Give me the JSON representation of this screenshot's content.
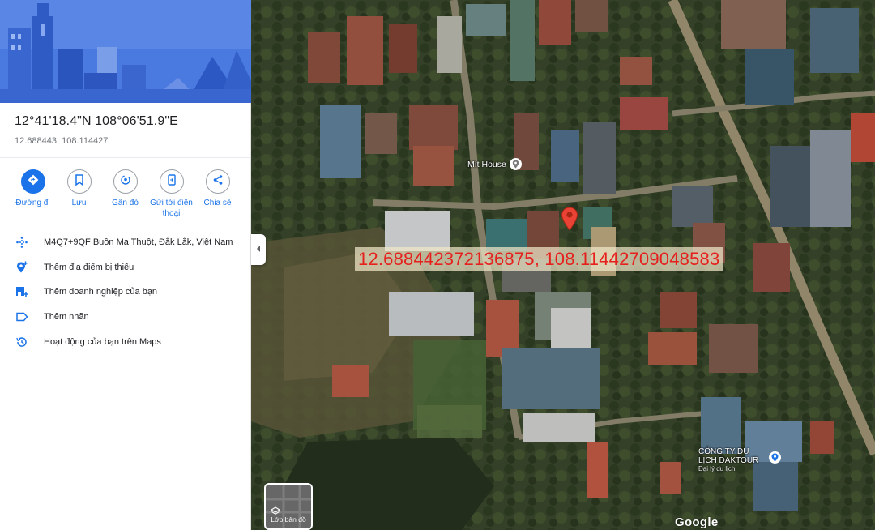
{
  "place": {
    "dms": "12°41'18.4\"N 108°06'51.9\"E",
    "decimal": "12.688443, 108.114427"
  },
  "actions": [
    {
      "label": "Đường đi",
      "icon": "directions-icon"
    },
    {
      "label": "Lưu",
      "icon": "bookmark-icon"
    },
    {
      "label": "Gần đó",
      "icon": "nearby-icon"
    },
    {
      "label": "Gửi tới điện thoại",
      "icon": "send-to-phone-icon"
    },
    {
      "label": "Chia sẻ",
      "icon": "share-icon"
    }
  ],
  "list": [
    {
      "label": "M4Q7+9QF Buôn Ma Thuột, Đắk Lắk, Việt Nam",
      "icon": "plus-code-icon"
    },
    {
      "label": "Thêm địa điểm bị thiếu",
      "icon": "add-place-icon"
    },
    {
      "label": "Thêm doanh nghiệp của bạn",
      "icon": "add-business-icon"
    },
    {
      "label": "Thêm nhãn",
      "icon": "label-icon"
    },
    {
      "label": "Hoạt động của bạn trên Maps",
      "icon": "history-icon"
    }
  ],
  "map": {
    "overlay_text": "12.688442372136875, 108.11442709048583",
    "poi_mit_house": "Mít House",
    "poi_dak_line1": "CÔNG TY DU",
    "poi_dak_line2": "LỊCH DAKTOUR",
    "poi_dak_line3": "Đại lý du lịch",
    "layer_label": "Lớp bản đồ",
    "logo": "Google"
  },
  "colors": {
    "accent": "#1a73e8",
    "pin": "#ea4335",
    "overlay_text": "#e5201d"
  }
}
